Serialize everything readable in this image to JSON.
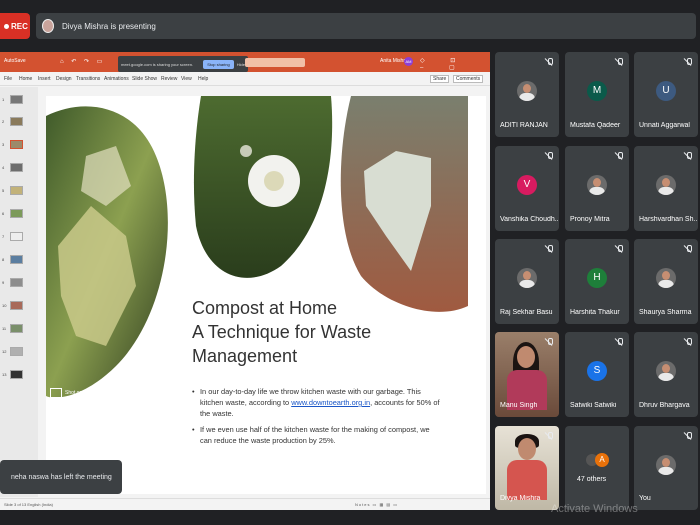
{
  "meet": {
    "rec_label": "REC",
    "presenting_text": "Divya Mishra is presenting"
  },
  "powerpoint": {
    "autosave_label": "AutoSave",
    "qat_icons": "⌂ ↶ ↷ ▭",
    "share_notice": "meet.google.com is sharing your screen.",
    "stop_sharing_label": "Stop sharing",
    "hide_label": "Hide",
    "user_name": "Anita Mishra",
    "user_initials": "AM",
    "window_controls": "◇ ⊡ – ▢ ✕",
    "menu": [
      "File",
      "Home",
      "Insert",
      "Design",
      "Transitions",
      "Animations",
      "Slide Show",
      "Review",
      "View",
      "Help"
    ],
    "share_label": "Share",
    "comments_label": "Comments",
    "thumbnail_numbers": [
      "1",
      "2",
      "3",
      "4",
      "5",
      "6",
      "7",
      "8",
      "9",
      "10",
      "11",
      "12",
      "13"
    ],
    "status_left": "Slide 3 of 13   English (India)",
    "status_right": "Notes  ▭ ▦ ▤ ▭"
  },
  "slide": {
    "title_line1": "Compost at Home",
    "title_line2": "A Technique for Waste",
    "title_line3": "Management",
    "bullet1_pre": "In our day-to-day life we throw kitchen waste with our garbage. This kitchen waste, according to ",
    "bullet1_link": "www.downtoearth.org.in",
    "bullet1_post": ", accounts for 50% of the waste.",
    "bullet2": "If we even use half of the kitchen waste for the making of compost, we can reduce the waste production by 25%.",
    "shot_credit": "Shot on OnePlus"
  },
  "toast": "neha naswa has left the meeting",
  "participants": [
    {
      "name": "ADITI RANJAN",
      "kind": "photo"
    },
    {
      "name": "Mustafa Qadeer",
      "kind": "letter",
      "letter": "M",
      "color": "#0b5a4a"
    },
    {
      "name": "Unnati Aggarwal",
      "kind": "letter",
      "letter": "U",
      "color": "#3d5a80"
    },
    {
      "name": "Vanshika Choudh...",
      "kind": "letter",
      "letter": "V",
      "color": "#d81b60"
    },
    {
      "name": "Pronoy Mitra",
      "kind": "photo"
    },
    {
      "name": "Harshvardhan Sh...",
      "kind": "photo"
    },
    {
      "name": "Raj Sekhar Basu",
      "kind": "photo"
    },
    {
      "name": "Harshita Thakur",
      "kind": "letter",
      "letter": "H",
      "color": "#1e7f3a"
    },
    {
      "name": "Shaurya Sharma",
      "kind": "photo"
    },
    {
      "name": "Manu Singh",
      "kind": "camera"
    },
    {
      "name": "Satwiki Satwiki",
      "kind": "letter",
      "letter": "S",
      "color": "#1a73e8"
    },
    {
      "name": "Dhruv Bhargava",
      "kind": "photo"
    },
    {
      "name": "Divya Mishra",
      "kind": "camera"
    },
    {
      "name": "47 others",
      "kind": "others",
      "letter": "A"
    },
    {
      "name": "You",
      "kind": "photo"
    }
  ],
  "watermark": "Activate Windows",
  "colors": {
    "meet_bg": "#202124",
    "tile_bg": "#3c4043",
    "rec_red": "#d93025",
    "ppt_orange": "#d35230"
  }
}
